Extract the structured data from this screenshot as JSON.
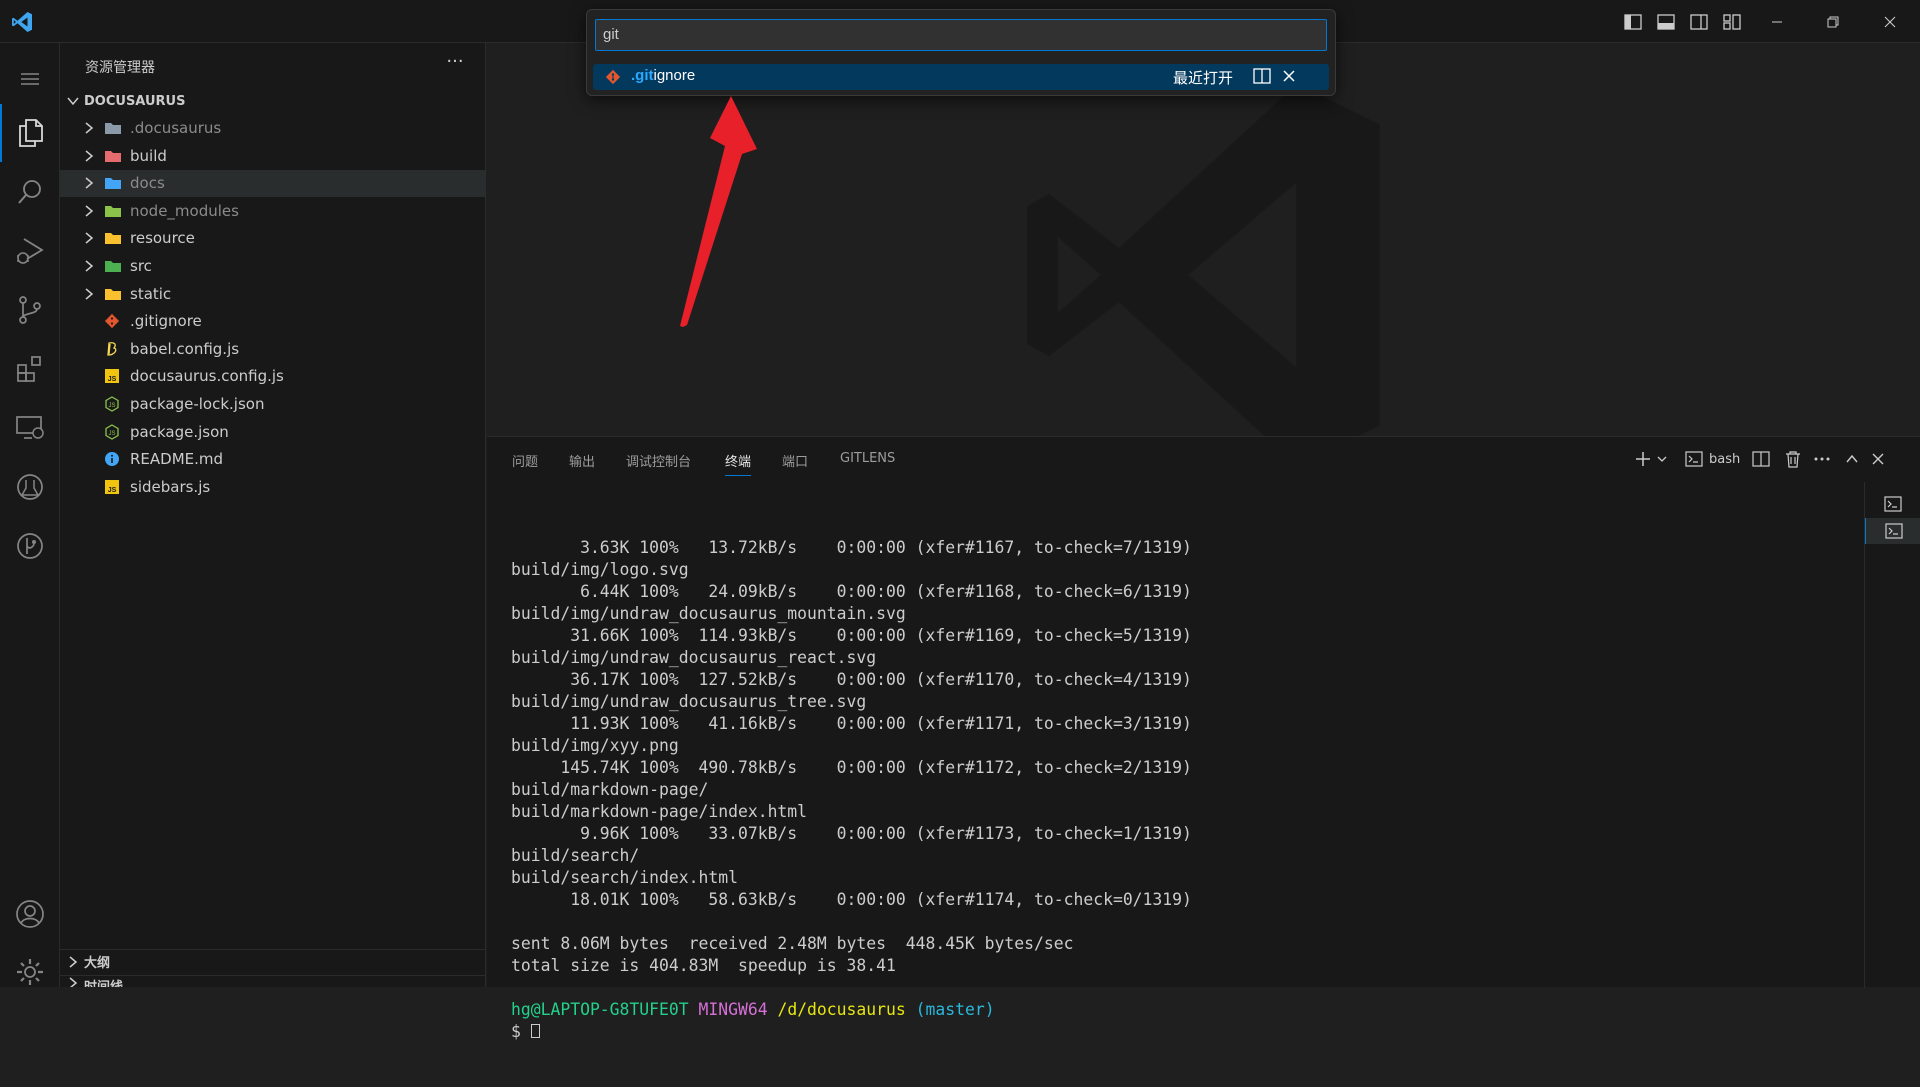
{
  "quick_pick": {
    "input_value": "git",
    "item": {
      "name_highlight": ".git",
      "name_rest": "ignore",
      "description": "最近打开"
    }
  },
  "sidebar": {
    "title": "资源管理器",
    "more": "···",
    "folder_name": "DOCUSAURUS",
    "items": [
      {
        "label": ".docusaurus",
        "type": "folder",
        "icon": "folder-grey-icon",
        "dim": true
      },
      {
        "label": "build",
        "type": "folder",
        "icon": "folder-red-icon",
        "dim": false
      },
      {
        "label": "docs",
        "type": "folder",
        "icon": "folder-blue-docs-icon",
        "dim": true,
        "selected": true
      },
      {
        "label": "node_modules",
        "type": "folder",
        "icon": "folder-green-node-icon",
        "dim": true
      },
      {
        "label": "resource",
        "type": "folder",
        "icon": "folder-yellow-icon",
        "dim": false
      },
      {
        "label": "src",
        "type": "folder",
        "icon": "folder-green-src-icon",
        "dim": false
      },
      {
        "label": "static",
        "type": "folder",
        "icon": "folder-yellow-icon",
        "dim": false
      },
      {
        "label": ".gitignore",
        "type": "file",
        "icon": "git-icon"
      },
      {
        "label": "babel.config.js",
        "type": "file",
        "icon": "babel-icon"
      },
      {
        "label": "docusaurus.config.js",
        "type": "file",
        "icon": "js-icon"
      },
      {
        "label": "package-lock.json",
        "type": "file",
        "icon": "nodejs-icon"
      },
      {
        "label": "package.json",
        "type": "file",
        "icon": "nodejs-icon"
      },
      {
        "label": "README.md",
        "type": "file",
        "icon": "info-icon"
      },
      {
        "label": "sidebars.js",
        "type": "file",
        "icon": "js-icon"
      }
    ],
    "outline_label": "大纲",
    "timeline_label": "时间线"
  },
  "panel": {
    "tabs": [
      "问题",
      "输出",
      "调试控制台",
      "终端",
      "端口",
      "GITLENS"
    ],
    "active_tab": "终端",
    "shell_label": "bash"
  },
  "terminal": {
    "lines": [
      "       3.63K 100%   13.72kB/s    0:00:00 (xfer#1167, to-check=7/1319)",
      "build/img/logo.svg",
      "       6.44K 100%   24.09kB/s    0:00:00 (xfer#1168, to-check=6/1319)",
      "build/img/undraw_docusaurus_mountain.svg",
      "      31.66K 100%  114.93kB/s    0:00:00 (xfer#1169, to-check=5/1319)",
      "build/img/undraw_docusaurus_react.svg",
      "      36.17K 100%  127.52kB/s    0:00:00 (xfer#1170, to-check=4/1319)",
      "build/img/undraw_docusaurus_tree.svg",
      "      11.93K 100%   41.16kB/s    0:00:00 (xfer#1171, to-check=3/1319)",
      "build/img/xyy.png",
      "     145.74K 100%  490.78kB/s    0:00:00 (xfer#1172, to-check=2/1319)",
      "build/markdown-page/",
      "build/markdown-page/index.html",
      "       9.96K 100%   33.07kB/s    0:00:00 (xfer#1173, to-check=1/1319)",
      "build/search/",
      "build/search/index.html",
      "      18.01K 100%   58.63kB/s    0:00:00 (xfer#1174, to-check=0/1319)",
      "",
      "sent 8.06M bytes  received 2.48M bytes  448.45K bytes/sec",
      "total size is 404.83M  speedup is 38.41",
      ""
    ],
    "prompt_user": "hg@LAPTOP-G8TUFE0T",
    "prompt_env": "MINGW64",
    "prompt_path": "/d/docusaurus",
    "prompt_branch": "(master)",
    "prompt_symbol": "$"
  },
  "colors": {
    "accent": "#0078d4",
    "quick_pick_selection": "#04395e",
    "highlight": "#2aaaff",
    "arrow": "#e8202a",
    "terminal_green": "#23d18b",
    "terminal_magenta": "#d670d6",
    "terminal_yellow": "#e5e510",
    "terminal_cyan": "#29b8db"
  }
}
